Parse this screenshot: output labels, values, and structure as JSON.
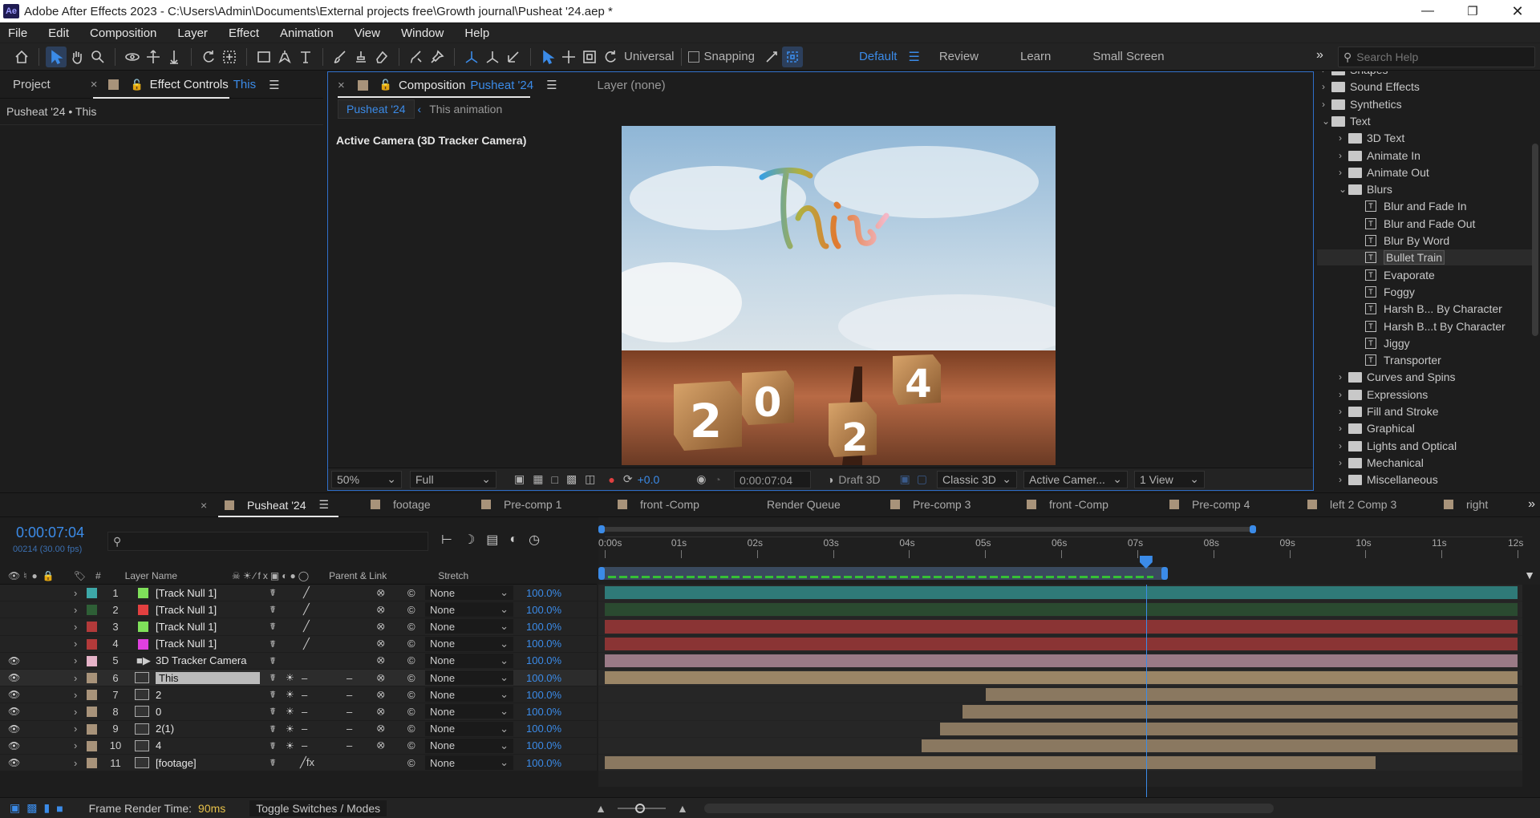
{
  "titlebar": {
    "title": "Adobe After Effects 2023 - C:\\Users\\Admin\\Documents\\External projects free\\Growth journal\\Pusheat '24.aep *",
    "app_icon": "Ae"
  },
  "menu": [
    "File",
    "Edit",
    "Composition",
    "Layer",
    "Effect",
    "Animation",
    "View",
    "Window",
    "Help"
  ],
  "toolbar": {
    "universal": "Universal",
    "snapping": "Snapping",
    "workspaces": [
      "Default",
      "Review",
      "Learn",
      "Small Screen"
    ],
    "search_placeholder": "Search Help"
  },
  "left_panel": {
    "tab_project": "Project",
    "tab_effect_controls": "Effect Controls",
    "effect_target": "This",
    "breadcrumb": "Pusheat '24 • This"
  },
  "comp_panel": {
    "tab_label": "Composition",
    "tab_comp": "Pusheat '24",
    "layer_tab": "Layer  (none)",
    "sub_tabs": [
      "Pusheat '24",
      "This animation"
    ],
    "camera_label": "Active Camera (3D Tracker Camera)",
    "preview_text": "This",
    "cubes": [
      "2",
      "0",
      "2",
      "4"
    ],
    "bottom": {
      "zoom": "50%",
      "resolution": "Full",
      "exposure": "+0.0",
      "timecode": "0:00:07:04",
      "draft": "Draft 3D",
      "renderer": "Classic 3D",
      "camera": "Active Camer...",
      "views": "1 View"
    }
  },
  "effects_tree": {
    "items": [
      {
        "label": "Shapes",
        "level": 0,
        "type": "folder",
        "open": false
      },
      {
        "label": "Sound Effects",
        "level": 0,
        "type": "folder",
        "open": false
      },
      {
        "label": "Synthetics",
        "level": 0,
        "type": "folder",
        "open": false
      },
      {
        "label": "Text",
        "level": 0,
        "type": "folder",
        "open": true
      },
      {
        "label": "3D Text",
        "level": 1,
        "type": "folder",
        "open": false
      },
      {
        "label": "Animate In",
        "level": 1,
        "type": "folder",
        "open": false
      },
      {
        "label": "Animate Out",
        "level": 1,
        "type": "folder",
        "open": false
      },
      {
        "label": "Blurs",
        "level": 1,
        "type": "folder",
        "open": true
      },
      {
        "label": "Blur and Fade In",
        "level": 2,
        "type": "preset"
      },
      {
        "label": "Blur and Fade Out",
        "level": 2,
        "type": "preset"
      },
      {
        "label": "Blur By Word",
        "level": 2,
        "type": "preset"
      },
      {
        "label": "Bullet Train",
        "level": 2,
        "type": "preset",
        "selected": true
      },
      {
        "label": "Evaporate",
        "level": 2,
        "type": "preset"
      },
      {
        "label": "Foggy",
        "level": 2,
        "type": "preset"
      },
      {
        "label": "Harsh B... By Character",
        "level": 2,
        "type": "preset"
      },
      {
        "label": "Harsh B...t By Character",
        "level": 2,
        "type": "preset"
      },
      {
        "label": "Jiggy",
        "level": 2,
        "type": "preset"
      },
      {
        "label": "Transporter",
        "level": 2,
        "type": "preset"
      },
      {
        "label": "Curves and Spins",
        "level": 1,
        "type": "folder",
        "open": false
      },
      {
        "label": "Expressions",
        "level": 1,
        "type": "folder",
        "open": false
      },
      {
        "label": "Fill and Stroke",
        "level": 1,
        "type": "folder",
        "open": false
      },
      {
        "label": "Graphical",
        "level": 1,
        "type": "folder",
        "open": false
      },
      {
        "label": "Lights and Optical",
        "level": 1,
        "type": "folder",
        "open": false
      },
      {
        "label": "Mechanical",
        "level": 1,
        "type": "folder",
        "open": false
      },
      {
        "label": "Miscellaneous",
        "level": 1,
        "type": "folder",
        "open": false
      }
    ]
  },
  "timeline": {
    "tabs": [
      "Pusheat '24",
      "footage",
      "Pre-comp 1",
      "front -Comp",
      "Render Queue",
      "Pre-comp 3",
      "front -Comp",
      "Pre-comp 4",
      "left 2 Comp 3",
      "right"
    ],
    "tab_colors": [
      "#a8937a",
      "#a8937a",
      "#a8937a",
      "#a8937a",
      "",
      "#a8937a",
      "#a8937a",
      "#a8937a",
      "#a8937a",
      "#a8937a"
    ],
    "timecode": "0:00:07:04",
    "frames": "00214 (30.00 fps)",
    "search_placeholder": "",
    "col_headers": {
      "num": "#",
      "name": "Layer Name",
      "parent": "Parent & Link",
      "stretch": "Stretch"
    },
    "ruler": [
      "0:00s",
      "01s",
      "02s",
      "03s",
      "04s",
      "05s",
      "06s",
      "07s",
      "08s",
      "09s",
      "10s",
      "11s",
      "12s"
    ],
    "playhead_fraction": 0.593,
    "layers": [
      {
        "num": "1",
        "name": "[Track Null 1]",
        "label": "#3da8a8",
        "swatch": "#7fe05a",
        "parent": "None",
        "stretch": "100.0%",
        "vis": false,
        "bar": "#2f7a78",
        "start": 0,
        "end": 1,
        "kind": "null"
      },
      {
        "num": "2",
        "name": "[Track Null 1]",
        "label": "#2e5f36",
        "swatch": "#e34040",
        "parent": "None",
        "stretch": "100.0%",
        "vis": false,
        "bar": "#2a4a30",
        "start": 0,
        "end": 1,
        "kind": "null"
      },
      {
        "num": "3",
        "name": "[Track Null 1]",
        "label": "#b33a3a",
        "swatch": "#7fe05a",
        "parent": "None",
        "stretch": "100.0%",
        "vis": false,
        "bar": "#8a3434",
        "start": 0,
        "end": 1,
        "kind": "null"
      },
      {
        "num": "4",
        "name": "[Track Null 1]",
        "label": "#b33a3a",
        "swatch": "#e040e0",
        "parent": "None",
        "stretch": "100.0%",
        "vis": false,
        "bar": "#8a3434",
        "start": 0,
        "end": 1,
        "kind": "null"
      },
      {
        "num": "5",
        "name": "3D Tracker Camera",
        "label": "#e6b3c8",
        "swatch": "",
        "parent": "None",
        "stretch": "100.0%",
        "vis": true,
        "bar": "#9a7a86",
        "start": 0,
        "end": 1,
        "kind": "camera"
      },
      {
        "num": "6",
        "name": "This",
        "label": "#a8937a",
        "swatch": "",
        "parent": "None",
        "stretch": "100.0%",
        "vis": true,
        "bar": "#9a8566",
        "start": 0,
        "end": 1,
        "kind": "comp",
        "selected": true
      },
      {
        "num": "7",
        "name": "2",
        "label": "#a8937a",
        "swatch": "",
        "parent": "None",
        "stretch": "100.0%",
        "vis": true,
        "bar": "#8a7860",
        "start": 0.415,
        "end": 1,
        "kind": "comp"
      },
      {
        "num": "8",
        "name": "0",
        "label": "#a8937a",
        "swatch": "",
        "parent": "None",
        "stretch": "100.0%",
        "vis": true,
        "bar": "#8a7860",
        "start": 0.39,
        "end": 1,
        "kind": "comp"
      },
      {
        "num": "9",
        "name": "2(1)",
        "label": "#a8937a",
        "swatch": "",
        "parent": "None",
        "stretch": "100.0%",
        "vis": true,
        "bar": "#8a7860",
        "start": 0.365,
        "end": 1,
        "kind": "comp"
      },
      {
        "num": "10",
        "name": "4",
        "label": "#a8937a",
        "swatch": "",
        "parent": "None",
        "stretch": "100.0%",
        "vis": true,
        "bar": "#8a7860",
        "start": 0.345,
        "end": 1,
        "kind": "comp"
      },
      {
        "num": "11",
        "name": "[footage]",
        "label": "#a8937a",
        "swatch": "",
        "parent": "None",
        "stretch": "100.0%",
        "vis": true,
        "bar": "#8a7860",
        "start": 0,
        "end": 0.845,
        "kind": "footage"
      }
    ],
    "footer": {
      "render_label": "Frame Render Time:",
      "render_value": "90ms",
      "toggle": "Toggle Switches / Modes"
    }
  }
}
